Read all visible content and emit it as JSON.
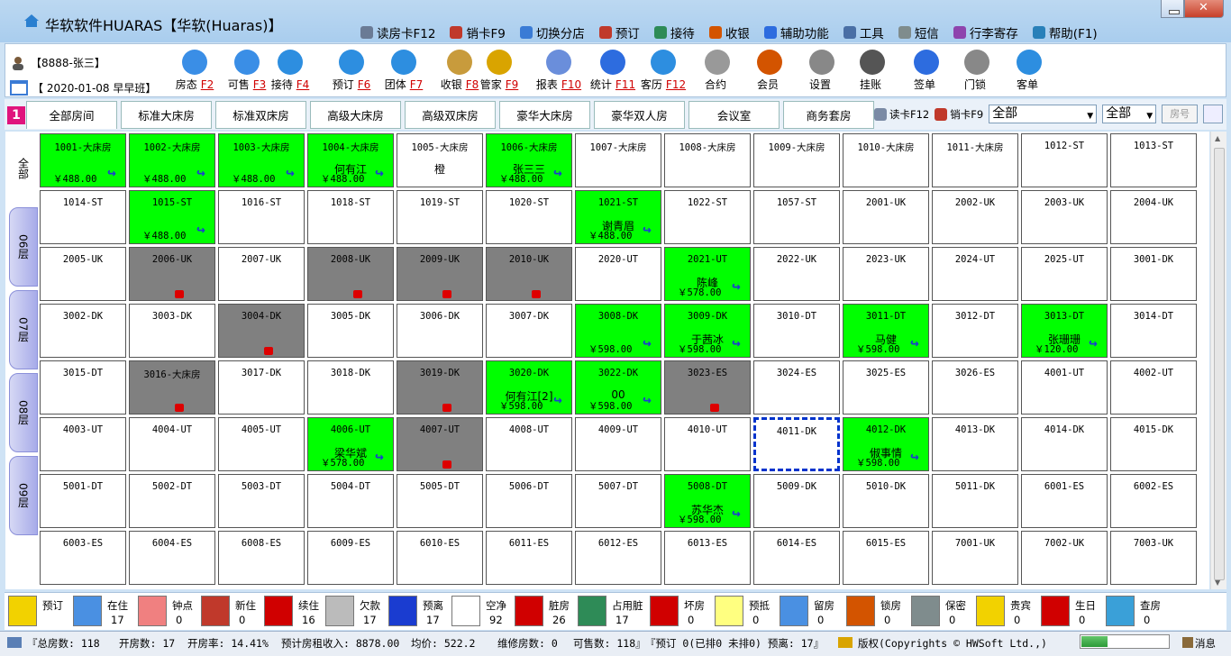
{
  "title": "华软软件HUARAS【华软(Huaras)】",
  "topmenu": [
    {
      "label": "读房卡F12",
      "icon": "card-reader-icon",
      "color": "#6a7b95"
    },
    {
      "label": "销卡F9",
      "icon": "cancel-card-icon",
      "color": "#c0392b"
    },
    {
      "label": "切换分店",
      "icon": "switch-branch-icon",
      "color": "#3a7bd5"
    },
    {
      "label": "预订",
      "icon": "phone-icon",
      "color": "#c0392b"
    },
    {
      "label": "接待",
      "icon": "reception-icon",
      "color": "#2e8b57"
    },
    {
      "label": "收银",
      "icon": "cashier-icon",
      "color": "#d35400"
    },
    {
      "label": "辅助功能",
      "icon": "tools-icon",
      "color": "#2d6cdf"
    },
    {
      "label": "工具",
      "icon": "gear-icon",
      "color": "#4a6fa5"
    },
    {
      "label": "短信",
      "icon": "sms-icon",
      "color": "#7f8c8d"
    },
    {
      "label": "行李寄存",
      "icon": "luggage-icon",
      "color": "#8e44ad"
    },
    {
      "label": "帮助(F1)",
      "icon": "help-icon",
      "color": "#2980b9"
    }
  ],
  "user": "【8888-张三】",
  "shift": "【 2020-01-08 早早班】",
  "toolbar": [
    {
      "label": "房态",
      "key": "F2",
      "icon": "home-icon",
      "color": "#3a8ee6"
    },
    {
      "label": "可售",
      "key": "F3",
      "icon": "person-sale-icon",
      "color": "#3a8ee6"
    },
    {
      "label": "接待",
      "key": "F4",
      "icon": "magnifier-icon",
      "color": "#2d8ee0"
    },
    {
      "label": "预订",
      "key": "F6",
      "icon": "clock-icon",
      "color": "#2d8ee0"
    },
    {
      "label": "团体",
      "key": "F7",
      "icon": "group-icon",
      "color": "#2d8ee0"
    },
    {
      "label": "收银",
      "key": "F8",
      "icon": "coins-icon",
      "color": "#c89b3c"
    },
    {
      "label": "管家",
      "key": "F9",
      "icon": "broom-icon",
      "color": "#d9a400"
    },
    {
      "label": "报表",
      "key": "F10",
      "icon": "report-icon",
      "color": "#6a8edb"
    },
    {
      "label": "统计",
      "key": "F11",
      "icon": "pencil-icon",
      "color": "#2d6cdf"
    },
    {
      "label": "客历",
      "key": "F12",
      "icon": "guest-history-icon",
      "color": "#2d8ee0"
    },
    {
      "label": "合约",
      "key": "",
      "icon": "contract-icon",
      "color": "#999999"
    },
    {
      "label": "会员",
      "key": "",
      "icon": "member-icon",
      "color": "#d35400"
    },
    {
      "label": "设置",
      "key": "",
      "icon": "settings-gear-icon",
      "color": "#888888"
    },
    {
      "label": "挂账",
      "key": "",
      "icon": "account-icon",
      "color": "#555555"
    },
    {
      "label": "签单",
      "key": "",
      "icon": "sign-icon",
      "color": "#2d6cdf"
    },
    {
      "label": "门锁",
      "key": "",
      "icon": "lock-icon",
      "color": "#888888"
    },
    {
      "label": "客单",
      "key": "",
      "icon": "search-guest-icon",
      "color": "#2d8ee0"
    }
  ],
  "tabs": [
    "全部房间",
    "标准大床房",
    "标准双床房",
    "高级大床房",
    "高级双床房",
    "豪华大床房",
    "豪华双人房",
    "会议室",
    "商务套房"
  ],
  "tab_num": "1",
  "tab_tools": {
    "read_card": "读卡F12",
    "cancel_card": "销卡F9",
    "filter1": "全部",
    "filter2": "全部",
    "room_placeholder": "房号"
  },
  "floors": [
    "全部",
    "06层",
    "07层",
    "08层",
    "09层"
  ],
  "rooms": [
    [
      {
        "n": "1001-大床房",
        "s": "occ",
        "p": "￥488.00"
      },
      {
        "n": "1002-大床房",
        "s": "occ",
        "p": "￥488.00"
      },
      {
        "n": "1003-大床房",
        "s": "occ",
        "p": "￥488.00"
      },
      {
        "n": "1004-大床房",
        "s": "occ",
        "g": "何有江",
        "p": "￥488.00"
      },
      {
        "n": "1005-大床房",
        "s": "vac",
        "g": "橙"
      },
      {
        "n": "1006-大床房",
        "s": "occ",
        "g": "张三三",
        "p": "￥488.00"
      },
      {
        "n": "1007-大床房",
        "s": "vac"
      },
      {
        "n": "1008-大床房",
        "s": "vac"
      },
      {
        "n": "1009-大床房",
        "s": "vac"
      },
      {
        "n": "1010-大床房",
        "s": "vac"
      },
      {
        "n": "1011-大床房",
        "s": "vac"
      },
      {
        "n": "1012-ST",
        "s": "vac"
      },
      {
        "n": "1013-ST",
        "s": "vac"
      }
    ],
    [
      {
        "n": "1014-ST",
        "s": "vac"
      },
      {
        "n": "1015-ST",
        "s": "occ",
        "p": "￥488.00"
      },
      {
        "n": "1016-ST",
        "s": "vac"
      },
      {
        "n": "1018-ST",
        "s": "vac"
      },
      {
        "n": "1019-ST",
        "s": "vac"
      },
      {
        "n": "1020-ST",
        "s": "vac"
      },
      {
        "n": "1021-ST",
        "s": "occ",
        "g": "谢青眉",
        "p": "￥488.00"
      },
      {
        "n": "1022-ST",
        "s": "vac"
      },
      {
        "n": "1057-ST",
        "s": "vac"
      },
      {
        "n": "2001-UK",
        "s": "vac"
      },
      {
        "n": "2002-UK",
        "s": "vac"
      },
      {
        "n": "2003-UK",
        "s": "vac"
      },
      {
        "n": "2004-UK",
        "s": "vac"
      }
    ],
    [
      {
        "n": "2005-UK",
        "s": "vac"
      },
      {
        "n": "2006-UK",
        "s": "dirty"
      },
      {
        "n": "2007-UK",
        "s": "vac"
      },
      {
        "n": "2008-UK",
        "s": "dirty"
      },
      {
        "n": "2009-UK",
        "s": "dirty"
      },
      {
        "n": "2010-UK",
        "s": "dirty"
      },
      {
        "n": "2020-UT",
        "s": "vac"
      },
      {
        "n": "2021-UT",
        "s": "occ",
        "g": "陈峰",
        "p": "￥578.00"
      },
      {
        "n": "2022-UK",
        "s": "vac"
      },
      {
        "n": "2023-UK",
        "s": "vac"
      },
      {
        "n": "2024-UT",
        "s": "vac"
      },
      {
        "n": "2025-UT",
        "s": "vac"
      },
      {
        "n": "3001-DK",
        "s": "vac"
      }
    ],
    [
      {
        "n": "3002-DK",
        "s": "vac"
      },
      {
        "n": "3003-DK",
        "s": "vac"
      },
      {
        "n": "3004-DK",
        "s": "dirty"
      },
      {
        "n": "3005-DK",
        "s": "vac"
      },
      {
        "n": "3006-DK",
        "s": "vac"
      },
      {
        "n": "3007-DK",
        "s": "vac"
      },
      {
        "n": "3008-DK",
        "s": "occ",
        "p": "￥598.00"
      },
      {
        "n": "3009-DK",
        "s": "occ",
        "g": "于茜冰",
        "p": "￥598.00"
      },
      {
        "n": "3010-DT",
        "s": "vac"
      },
      {
        "n": "3011-DT",
        "s": "occ",
        "g": "马健",
        "p": "￥598.00"
      },
      {
        "n": "3012-DT",
        "s": "vac"
      },
      {
        "n": "3013-DT",
        "s": "occ",
        "g": "张珊珊",
        "p": "￥120.00"
      },
      {
        "n": "3014-DT",
        "s": "vac"
      }
    ],
    [
      {
        "n": "3015-DT",
        "s": "vac"
      },
      {
        "n": "3016-大床房",
        "s": "dirty"
      },
      {
        "n": "3017-DK",
        "s": "vac"
      },
      {
        "n": "3018-DK",
        "s": "vac"
      },
      {
        "n": "3019-DK",
        "s": "dirty"
      },
      {
        "n": "3020-DK",
        "s": "occ",
        "g": "何有江[2]",
        "p": "￥598.00"
      },
      {
        "n": "3022-DK",
        "s": "occ",
        "g": "00",
        "p": "￥598.00"
      },
      {
        "n": "3023-ES",
        "s": "dirty"
      },
      {
        "n": "3024-ES",
        "s": "vac"
      },
      {
        "n": "3025-ES",
        "s": "vac"
      },
      {
        "n": "3026-ES",
        "s": "vac"
      },
      {
        "n": "4001-UT",
        "s": "vac"
      },
      {
        "n": "4002-UT",
        "s": "vac"
      }
    ],
    [
      {
        "n": "4003-UT",
        "s": "vac"
      },
      {
        "n": "4004-UT",
        "s": "vac"
      },
      {
        "n": "4005-UT",
        "s": "vac"
      },
      {
        "n": "4006-UT",
        "s": "occ",
        "g": "梁华斌",
        "p": "￥578.00"
      },
      {
        "n": "4007-UT",
        "s": "dirty"
      },
      {
        "n": "4008-UT",
        "s": "vac"
      },
      {
        "n": "4009-UT",
        "s": "vac"
      },
      {
        "n": "4010-UT",
        "s": "vac"
      },
      {
        "n": "4011-DK",
        "s": "selected"
      },
      {
        "n": "4012-DK",
        "s": "occ",
        "g": "俶事情",
        "p": "￥598.00"
      },
      {
        "n": "4013-DK",
        "s": "vac"
      },
      {
        "n": "4014-DK",
        "s": "vac"
      },
      {
        "n": "4015-DK",
        "s": "vac"
      }
    ],
    [
      {
        "n": "5001-DT",
        "s": "vac"
      },
      {
        "n": "5002-DT",
        "s": "vac"
      },
      {
        "n": "5003-DT",
        "s": "vac"
      },
      {
        "n": "5004-DT",
        "s": "vac"
      },
      {
        "n": "5005-DT",
        "s": "vac"
      },
      {
        "n": "5006-DT",
        "s": "vac"
      },
      {
        "n": "5007-DT",
        "s": "vac"
      },
      {
        "n": "5008-DT",
        "s": "occ",
        "g": "苏华杰",
        "p": "￥598.00"
      },
      {
        "n": "5009-DK",
        "s": "vac"
      },
      {
        "n": "5010-DK",
        "s": "vac"
      },
      {
        "n": "5011-DK",
        "s": "vac"
      },
      {
        "n": "6001-ES",
        "s": "vac"
      },
      {
        "n": "6002-ES",
        "s": "vac"
      }
    ],
    [
      {
        "n": "6003-ES",
        "s": "vac"
      },
      {
        "n": "6004-ES",
        "s": "vac"
      },
      {
        "n": "6008-ES",
        "s": "vac"
      },
      {
        "n": "6009-ES",
        "s": "vac"
      },
      {
        "n": "6010-ES",
        "s": "vac"
      },
      {
        "n": "6011-ES",
        "s": "vac"
      },
      {
        "n": "6012-ES",
        "s": "vac"
      },
      {
        "n": "6013-ES",
        "s": "vac"
      },
      {
        "n": "6014-ES",
        "s": "vac"
      },
      {
        "n": "6015-ES",
        "s": "vac"
      },
      {
        "n": "7001-UK",
        "s": "vac"
      },
      {
        "n": "7002-UK",
        "s": "vac"
      },
      {
        "n": "7003-UK",
        "s": "vac"
      }
    ]
  ],
  "legend": [
    {
      "label": "预订",
      "value": "",
      "color": "#f2d200",
      "icon": "arrow-left-icon"
    },
    {
      "label": "在住",
      "value": "17",
      "color": "#4a90e2",
      "icon": "guest-icon"
    },
    {
      "label": "钟点",
      "value": "0",
      "color": "#f08080",
      "icon": "hourly-swatch"
    },
    {
      "label": "新住",
      "value": "0",
      "color": "#c0392b",
      "icon": "new-checkin-icon"
    },
    {
      "label": "续住",
      "value": "16",
      "color": "#d00000",
      "icon": "extend-icon"
    },
    {
      "label": "欠款",
      "value": "17",
      "color": "#bbbbbb",
      "icon": "yen-icon"
    },
    {
      "label": "预离",
      "value": "17",
      "color": "#1a3cd0",
      "icon": "due-out-icon"
    },
    {
      "label": "空净",
      "value": "92",
      "color": "#ffffff",
      "icon": "vacant-clean-swatch"
    },
    {
      "label": "脏房",
      "value": "26",
      "color": "#d00000",
      "icon": "dirty-icon"
    },
    {
      "label": "占用脏",
      "value": "17",
      "color": "#2e8b57",
      "icon": "occupied-dirty-icon"
    },
    {
      "label": "坏房",
      "value": "0",
      "color": "#d00000",
      "icon": "out-of-order-swatch"
    },
    {
      "label": "预抵",
      "value": "0",
      "color": "#ffff80",
      "icon": "arrival-swatch"
    },
    {
      "label": "留房",
      "value": "0",
      "color": "#4a90e2",
      "icon": "hold-room-icon"
    },
    {
      "label": "锁房",
      "value": "0",
      "color": "#d35400",
      "icon": "lock-room-icon"
    },
    {
      "label": "保密",
      "value": "0",
      "color": "#7f8c8d",
      "icon": "privacy-icon"
    },
    {
      "label": "贵宾",
      "value": "0",
      "color": "#f2d200",
      "icon": "vip-star-icon"
    },
    {
      "label": "生日",
      "value": "0",
      "color": "#d00000",
      "icon": "birthday-gift-icon"
    },
    {
      "label": "查房",
      "value": "0",
      "color": "#3aa0d8",
      "icon": "inspect-icon"
    }
  ],
  "status": {
    "total_rooms": "『总房数: 118",
    "available": "开房数: 17",
    "rate": "开房率: 14.41%",
    "revenue": "预计房租收入: 8878.00",
    "avg": "均价:    522.2",
    "repair": "维修房数: 0",
    "sellable": "可售数: 118』",
    "booking": "『预订 0(已排0 未排0) 预离: 17』",
    "copyright": "版权(Copyrights © HWSoft Ltd.,)",
    "message": "消息",
    "progress": 0.3
  }
}
